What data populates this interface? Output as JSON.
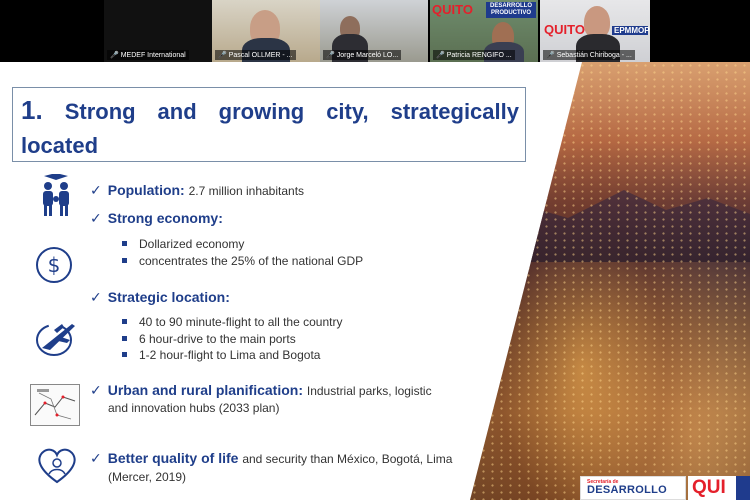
{
  "participants": [
    {
      "name": "MEDEF International"
    },
    {
      "name": "Pascal OLLMER - ..."
    },
    {
      "name": "Jorge Marceló LO..."
    },
    {
      "name": "Patricia RENGIFO ..."
    },
    {
      "name": "Sebastián Chiriboga - ..."
    }
  ],
  "tile_logos": {
    "quito": "QUITO",
    "desarrollo": "DESARROLLO PRODUCTIVO",
    "epmmop": "EPMMOP"
  },
  "slide": {
    "title_num": "1.",
    "title": "Strong and growing city, strategically located",
    "items": {
      "population": {
        "head": "Population:",
        "rest": "2.7 million inhabitants"
      },
      "economy": {
        "head": "Strong economy:",
        "bullets": [
          "Dollarized economy",
          "concentrates the 25% of the national GDP"
        ]
      },
      "location": {
        "head": "Strategic location:",
        "bullets": [
          "40 to 90 minute-flight to all the country",
          "6 hour-drive to the main ports",
          "1-2 hour-flight to Lima and Bogota"
        ]
      },
      "urban": {
        "head": "Urban and rural planification:",
        "rest": "Industrial parks, logistic",
        "rest2": "and innovation hubs (2033 plan)"
      },
      "life": {
        "head": "Better quality of life",
        "rest": "and security than México, Bogotá, Lima",
        "rest2": "(Mercer, 2019)"
      }
    },
    "check": "✓",
    "footer": {
      "secretaria": "Secretaría de",
      "desarrollo": "DESARROLLO",
      "quito": "QUI"
    }
  }
}
